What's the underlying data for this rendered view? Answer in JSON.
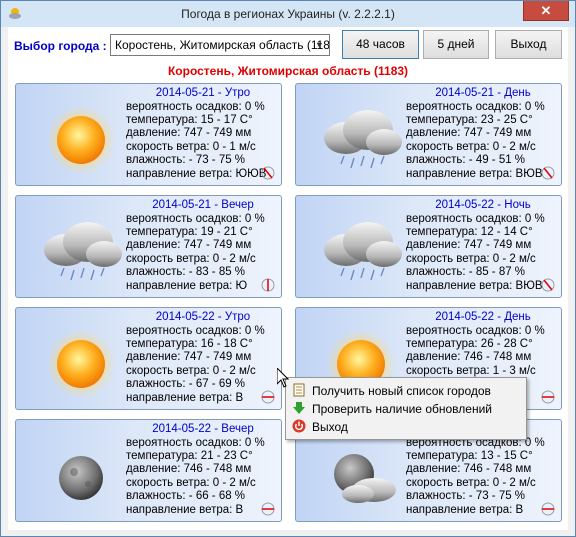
{
  "window": {
    "title": "Погода в регионах Украины (v. 2.2.2.1)",
    "close_label": "✕"
  },
  "toolbar": {
    "city_label": "Выбор города :",
    "city_select_value": "Коростень, Житомирская область (118",
    "btn_48h": "48 часов",
    "btn_5d": "5 дней",
    "btn_exit": "Выход"
  },
  "selected_city": "Коростень, Житомирская область (1183)",
  "cards": [
    {
      "head": "2014-05-21 - Утро",
      "icon": "sun-icon",
      "l1": "вероятность осадков: 0 %",
      "l2": "температура: 15 - 17 C°",
      "l3": "давление: 747 - 749 мм",
      "l4": "скорость ветра: 0 - 1 м/с",
      "l5": "влажность: - 73 - 75 %",
      "l6": "направление ветра: ЮЮВ"
    },
    {
      "head": "2014-05-21 - День",
      "icon": "cloud-rain-icon",
      "l1": "вероятность осадков: 0 %",
      "l2": "температура: 23 - 25 C°",
      "l3": "давление: 747 - 749 мм",
      "l4": "скорость ветра: 0 - 2 м/с",
      "l5": "влажность: - 49 - 51 %",
      "l6": "направление ветра: ВЮВ"
    },
    {
      "head": "2014-05-21 - Вечер",
      "icon": "cloud-rain-icon",
      "l1": "вероятность осадков: 0 %",
      "l2": "температура: 19 - 21 C°",
      "l3": "давление: 747 - 749 мм",
      "l4": "скорость ветра: 0 - 2 м/с",
      "l5": "влажность: - 83 - 85 %",
      "l6": "направление ветра: Ю"
    },
    {
      "head": "2014-05-22 - Ночь",
      "icon": "cloud-rain-icon",
      "l1": "вероятность осадков: 0 %",
      "l2": "температура: 12 - 14 C°",
      "l3": "давление: 747 - 749 мм",
      "l4": "скорость ветра: 0 - 2 м/с",
      "l5": "влажность: - 85 - 87 %",
      "l6": "направление ветра: ВЮВ"
    },
    {
      "head": "2014-05-22 - Утро",
      "icon": "sun-icon",
      "l1": "вероятность осадков: 0 %",
      "l2": "температура: 16 - 18 C°",
      "l3": "давление: 747 - 749 мм",
      "l4": "скорость ветра: 0 - 2 м/с",
      "l5": "влажность: - 67 - 69 %",
      "l6": "направление ветра: В"
    },
    {
      "head": "2014-05-22 - День",
      "icon": "sun-icon",
      "l1": "вероятность осадков: 0 %",
      "l2": "температура: 26 - 28 C°",
      "l3": "давление: 746 - 748 мм",
      "l4": "скорость ветра: 1 - 3 м/с",
      "l5": "",
      "l6": ""
    },
    {
      "head": "2014-05-22 - Вечер",
      "icon": "moon-icon",
      "l1": "вероятность осадков: 0 %",
      "l2": "температура: 21 - 23 C°",
      "l3": "давление: 746 - 748 мм",
      "l4": "скорость ветра: 0 - 2 м/с",
      "l5": "влажность: - 66 - 68 %",
      "l6": "направление ветра: В"
    },
    {
      "head": "",
      "icon": "moon-cloud-icon",
      "l1": "вероятность осадков: 0 %",
      "l2": "температура: 13 - 15 C°",
      "l3": "давление: 746 - 748 мм",
      "l4": "скорость ветра: 0 - 2 м/с",
      "l5": "влажность: - 73 - 75 %",
      "l6": "направление ветра: В"
    }
  ],
  "context_menu": [
    {
      "label": "Получить новый список городов",
      "icon": "list-icon"
    },
    {
      "label": "Проверить наличие обновлений",
      "icon": "download-arrow-icon"
    },
    {
      "label": "Выход",
      "icon": "power-icon"
    }
  ]
}
